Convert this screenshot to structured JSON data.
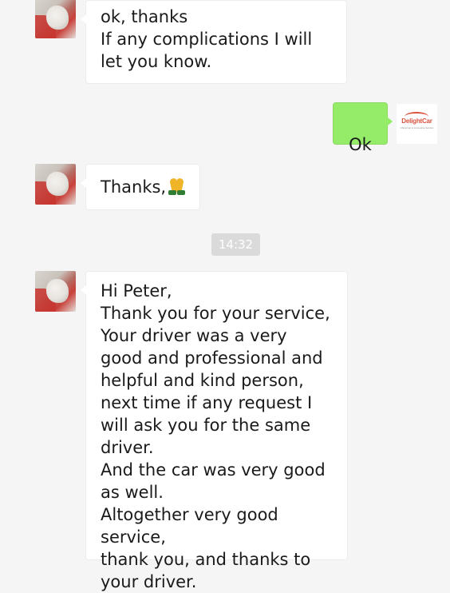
{
  "messages": [
    {
      "side": "left",
      "text": "ok, thanks\nIf any complications I will let you know."
    },
    {
      "side": "right",
      "text": "Ok"
    },
    {
      "side": "left",
      "text": "Thanks,",
      "emoji": "folded-hands"
    },
    {
      "side": "left",
      "text": "Hi Peter,\nThank you for your service,\nYour driver was a very good and professional and helpful and kind person, next time if any request I will ask you for the same driver.\nAnd the car was very good as well.\nAltogether very good service,\n thank you, and thanks to your driver."
    }
  ],
  "timestamp": "14:32",
  "logo": {
    "brand": "DelightCar",
    "tagline": "China Car & Limousine Service",
    "color": "#d9533f"
  },
  "colors": {
    "background": "#f5f5f5",
    "sent_bubble": "#95ec69",
    "received_bubble": "#ffffff",
    "timestamp_bg": "#dadada"
  }
}
